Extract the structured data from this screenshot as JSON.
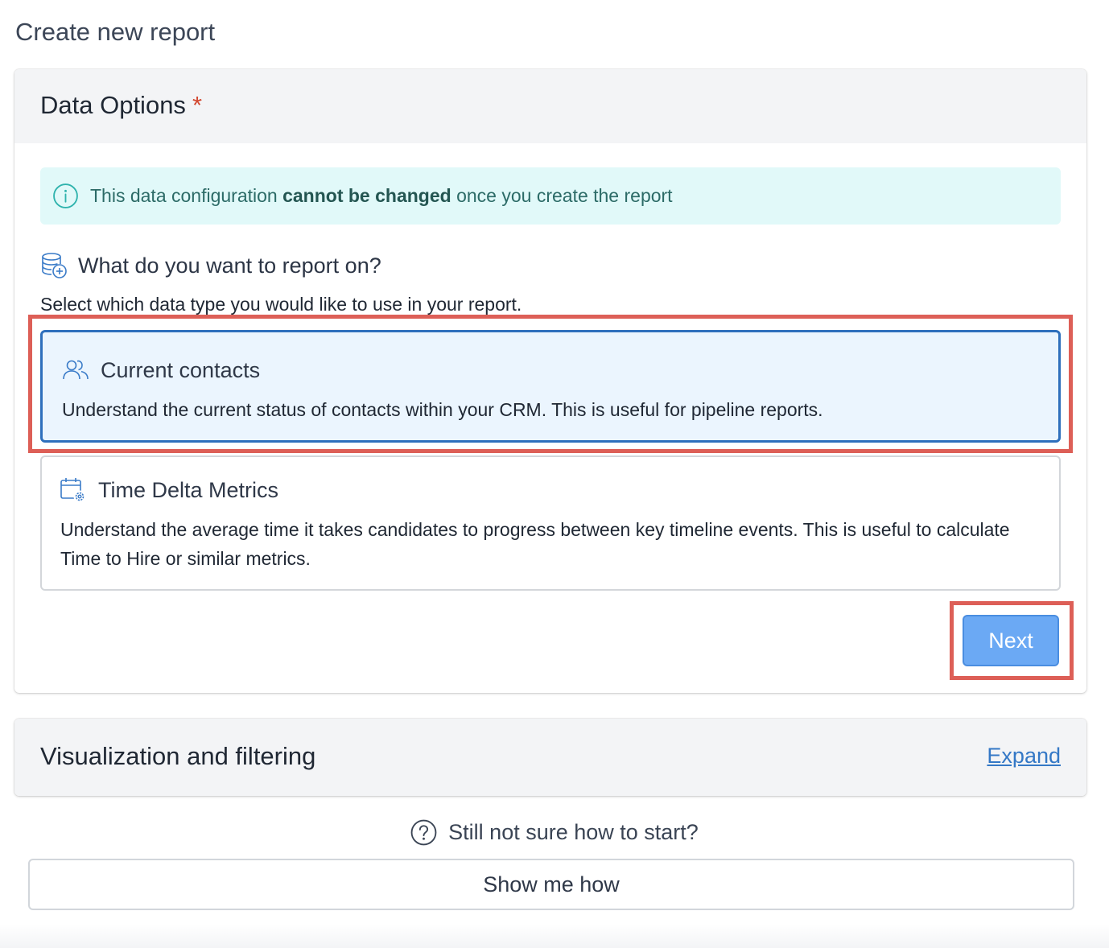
{
  "page": {
    "title": "Create new report"
  },
  "data_options": {
    "title": "Data Options",
    "required_marker": "*",
    "info_banner": {
      "icon": "info-icon",
      "text_before": "This data configuration ",
      "text_bold": "cannot be changed",
      "text_after": " once you create the report"
    },
    "question": {
      "icon": "database-add-icon",
      "text": "What do you want to report on?"
    },
    "subtext": "Select which data type you would like to use in your report.",
    "options": [
      {
        "icon": "users-icon",
        "title": "Current contacts",
        "description": "Understand the current status of contacts within your CRM. This is useful for pipeline reports.",
        "selected": true
      },
      {
        "icon": "calendar-gear-icon",
        "title": "Time Delta Metrics",
        "description": "Understand the average time it takes candidates to progress between key timeline events. This is useful to calculate Time to Hire or similar metrics.",
        "selected": false
      }
    ],
    "next_label": "Next"
  },
  "visualization": {
    "title": "Visualization and filtering",
    "expand_label": "Expand"
  },
  "help": {
    "icon": "question-circle-icon",
    "text": "Still not sure how to start?",
    "button_label": "Show me how"
  },
  "colors": {
    "required": "#d2462e",
    "banner_bg": "#e1f9f9",
    "selected_border": "#2e6fbc",
    "selected_bg": "#ebf5fe",
    "primary_button": "#6ba9f4",
    "highlight": "#dd5f57",
    "link": "#3478c6"
  }
}
